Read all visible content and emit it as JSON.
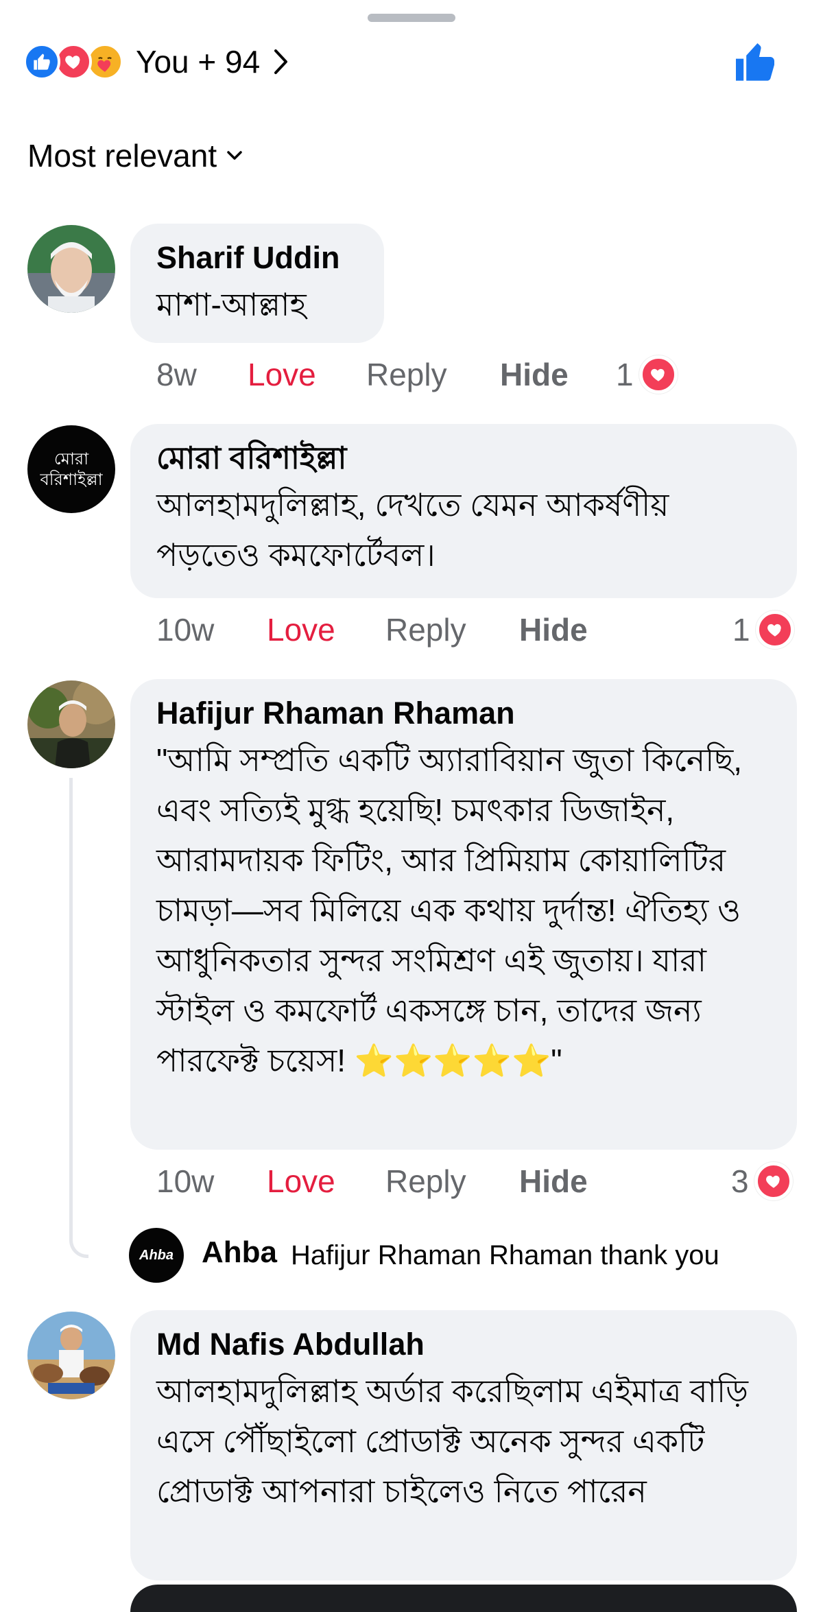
{
  "header": {
    "reaction_summary": "You + 94",
    "reaction_icons": [
      "like-icon",
      "love-icon",
      "care-icon"
    ],
    "like_button_icon": "thumbs-up-icon"
  },
  "sort": {
    "label": "Most relevant"
  },
  "colors": {
    "love": "#e41e3f",
    "like": "#1877f2",
    "bubble": "#f0f2f5",
    "muted": "#65676b"
  },
  "actions": {
    "love": "Love",
    "reply": "Reply",
    "hide": "Hide"
  },
  "comments": [
    {
      "author": "Sharif Uddin",
      "text": "মাশা-আল্লাহ",
      "time": "8w",
      "reaction_count": "1"
    },
    {
      "author": "মোরা বরিশাইল্লা",
      "avatar_text": "মোরা বরিশাইল্লা",
      "text": "আলহামদুলিল্লাহ, দেখতে যেমন আকর্ষণীয় পড়তেও কমফোর্টেবল।",
      "time": "10w",
      "reaction_count": "1"
    },
    {
      "author": "Hafijur Rhaman Rhaman",
      "text": "\"আমি সম্প্রতি একটি অ্যারাবিয়ান জুতা কিনেছি, এবং সত্যিই মুগ্ধ হয়েছি! চমৎকার ডিজাইন, আরামদায়ক ফিটিং, আর প্রিমিয়াম কোয়ালিটির চামড়া—সব মিলিয়ে এক কথায় দুর্দান্ত! ঐতিহ্য ও আধুনিকতার সুন্দর সংমিশ্রণ এই জুতায়। যারা স্টাইল ও কমফোর্ট একসঙ্গে চান, তাদের জন্য পারফেক্ট চয়েস! ⭐⭐⭐⭐⭐\"",
      "time": "10w",
      "reaction_count": "3",
      "reply": {
        "avatar_text": "Ahba",
        "author": "Ahba",
        "text": "Hafijur Rhaman Rhaman thank you"
      }
    },
    {
      "author": "Md Nafis Abdullah",
      "text": "আলহামদুলিল্লাহ অর্ডার করেছিলাম এইমাত্র বাড়ি এসে পৌঁছাইলো প্রোডাক্ট অনেক সুন্দর একটি প্রোডাক্ট আপনারা চাইলেও নিতে পারেন"
    }
  ]
}
